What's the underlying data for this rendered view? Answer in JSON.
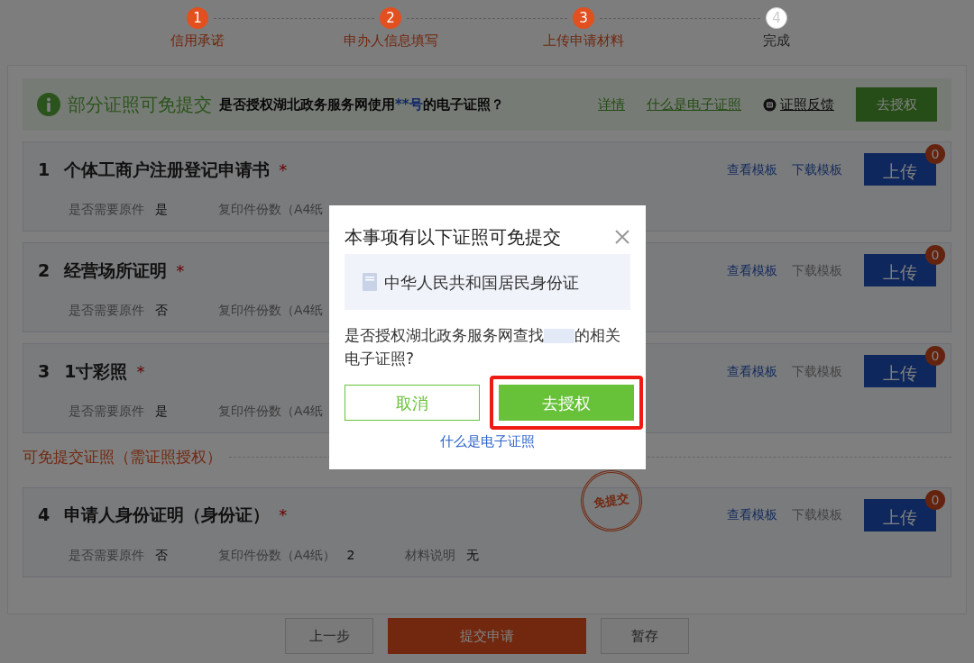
{
  "steps": [
    {
      "number": "1",
      "label": "信用承诺",
      "done": true
    },
    {
      "number": "2",
      "label": "申办人信息填写",
      "done": true
    },
    {
      "number": "3",
      "label": "上传申请材料",
      "done": true
    },
    {
      "number": "4",
      "label": "完成",
      "done": false
    }
  ],
  "banner": {
    "title": "部分证照可免提交",
    "question_before": "是否授权湖北政务服务网使用",
    "question_highlight": "**号",
    "question_after": "的电子证照？",
    "links": [
      "详情",
      "什么是电子证照"
    ],
    "feedback": "证照反馈",
    "button": "去授权"
  },
  "materials": [
    {
      "number": "1",
      "name": "个体工商户注册登记申请书",
      "required_mark": "*",
      "view": "查看模板",
      "download": "下载模板",
      "download_disabled": false,
      "upload": "上传",
      "upload_count": "0",
      "details": [
        {
          "label": "是否需要原件",
          "value": "是"
        },
        {
          "label": "复印件份数（A4纸"
        }
      ]
    },
    {
      "number": "2",
      "name": "经营场所证明",
      "required_mark": "*",
      "view": "查看模板",
      "download": "下载模板",
      "download_disabled": true,
      "upload": "上传",
      "upload_count": "0",
      "details": [
        {
          "label": "是否需要原件",
          "value": "否"
        },
        {
          "label": "复印件份数（A4纸"
        }
      ]
    },
    {
      "number": "3",
      "name": "1寸彩照",
      "required_mark": "*",
      "view": "查看模板",
      "download": "下载模板",
      "download_disabled": true,
      "upload": "上传",
      "upload_count": "0",
      "details": [
        {
          "label": "是否需要原件",
          "value": "是"
        },
        {
          "label": "复印件份数（A4纸"
        }
      ]
    }
  ],
  "exempt_section": {
    "heading": "可免提交证照（需证照授权）",
    "materials": [
      {
        "number": "4",
        "name": "申请人身份证明（身份证）",
        "required_mark": "*",
        "stamp": "免提交",
        "view": "查看模板",
        "download": "下载模板",
        "download_disabled": true,
        "upload": "上传",
        "upload_count": "0",
        "details": [
          {
            "label": "是否需要原件",
            "value": "否"
          },
          {
            "label": "复印件份数（A4纸）",
            "value": "2"
          },
          {
            "label": "材料说明",
            "value": "无"
          }
        ]
      }
    ]
  },
  "footer": {
    "buttons": [
      {
        "label": "上一步",
        "kind": "secondary"
      },
      {
        "label": "提交申请",
        "kind": "primary"
      },
      {
        "label": "暂存",
        "kind": "secondary"
      }
    ]
  },
  "dialog": {
    "title": "本事项有以下证照可免提交",
    "licenses": [
      "中华人民共和国居民身份证"
    ],
    "question_before": "是否授权湖北政务服务网查找",
    "question_after": "的相关电子证照?",
    "cancel": "取消",
    "confirm": "去授权",
    "confirm_highlighted": true,
    "link": "什么是电子证照"
  }
}
